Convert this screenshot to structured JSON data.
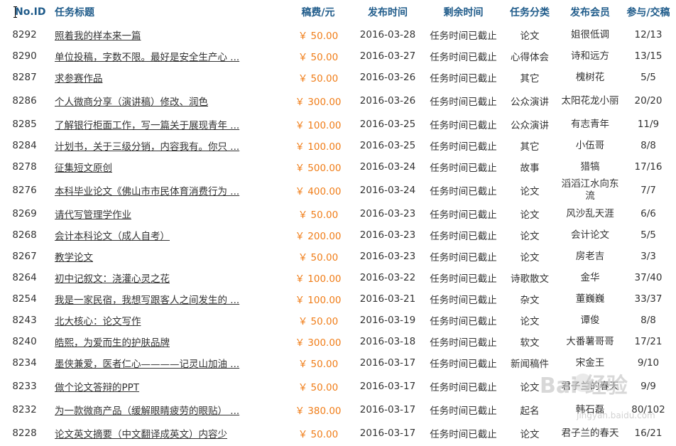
{
  "headers": {
    "id": "No.ID",
    "title": "任务标题",
    "fee": "稿费/元",
    "publish_time": "发布时间",
    "remaining": "剩余时间",
    "category": "任务分类",
    "member": "发布会员",
    "participation": "参与/交稿"
  },
  "rows": [
    {
      "id": "8292",
      "title": "照着我的样本来一篇",
      "fee": "￥ 50.00",
      "date": "2016-03-28",
      "remaining": "任务时间已截止",
      "category": "论文",
      "member": "姐很低调",
      "part": "12/13"
    },
    {
      "id": "8290",
      "title": "单位投稿，字数不限。最好是安全生产心 ...",
      "fee": "￥ 50.00",
      "date": "2016-03-27",
      "remaining": "任务时间已截止",
      "category": "心得体会",
      "member": "诗和远方",
      "part": "13/15"
    },
    {
      "id": "8287",
      "title": "求参赛作品",
      "fee": "￥ 50.00",
      "date": "2016-03-26",
      "remaining": "任务时间已截止",
      "category": "其它",
      "member": "槐树花",
      "part": "5/5"
    },
    {
      "id": "8286",
      "title": "个人微商分享（演讲稿）修改、润色",
      "fee": "￥ 300.00",
      "date": "2016-03-26",
      "remaining": "任务时间已截止",
      "category": "公众演讲",
      "member": "太阳花龙小丽",
      "part": "20/20",
      "tall": true
    },
    {
      "id": "8285",
      "title": "了解银行柜面工作，写一篇关于展现青年 ...",
      "fee": "￥ 100.00",
      "date": "2016-03-25",
      "remaining": "任务时间已截止",
      "category": "公众演讲",
      "member": "有志青年",
      "part": "11/9"
    },
    {
      "id": "8284",
      "title": "计划书，关于三级分销，内容我有。你只 ...",
      "fee": "￥ 100.00",
      "date": "2016-03-25",
      "remaining": "任务时间已截止",
      "category": "其它",
      "member": "小伍哥",
      "part": "8/8"
    },
    {
      "id": "8278",
      "title": "征集短文原创",
      "fee": "￥ 500.00",
      "date": "2016-03-24",
      "remaining": "任务时间已截止",
      "category": "故事",
      "member": "猎犒",
      "part": "17/16"
    },
    {
      "id": "8276",
      "title": "本科毕业论文《佛山市市民体育消费行为 ...",
      "fee": "￥ 400.00",
      "date": "2016-03-24",
      "remaining": "任务时间已截止",
      "category": "论文",
      "member": "滔滔江水向东流",
      "part": "7/7",
      "tall": true
    },
    {
      "id": "8269",
      "title": "请代写管理学作业",
      "fee": "￥ 50.00",
      "date": "2016-03-23",
      "remaining": "任务时间已截止",
      "category": "论文",
      "member": "风沙乱天涯",
      "part": "6/6"
    },
    {
      "id": "8268",
      "title": "会计本科论文（成人自考）",
      "fee": "￥ 200.00",
      "date": "2016-03-23",
      "remaining": "任务时间已截止",
      "category": "论文",
      "member": "会计论文",
      "part": "5/5"
    },
    {
      "id": "8267",
      "title": "教学论文",
      "fee": "￥ 50.00",
      "date": "2016-03-23",
      "remaining": "任务时间已截止",
      "category": "论文",
      "member": "房老吉",
      "part": "3/3"
    },
    {
      "id": "8264",
      "title": "初中记叙文：浇灌心灵之花",
      "fee": "￥ 100.00",
      "date": "2016-03-22",
      "remaining": "任务时间已截止",
      "category": "诗歌散文",
      "member": "金华",
      "part": "37/40"
    },
    {
      "id": "8254",
      "title": "我是一家民宿，我想写跟客人之间发生的 ...",
      "fee": "￥ 100.00",
      "date": "2016-03-21",
      "remaining": "任务时间已截止",
      "category": "杂文",
      "member": "董巍巍",
      "part": "33/37"
    },
    {
      "id": "8243",
      "title": "北大核心：论文写作",
      "fee": "￥ 50.00",
      "date": "2016-03-19",
      "remaining": "任务时间已截止",
      "category": "论文",
      "member": "谭俊",
      "part": "8/8"
    },
    {
      "id": "8240",
      "title": "皓熙，为爱而生的护肤品牌",
      "fee": "￥ 300.00",
      "date": "2016-03-18",
      "remaining": "任务时间已截止",
      "category": "软文",
      "member": "大番薯哥哥",
      "part": "17/21"
    },
    {
      "id": "8234",
      "title": "墨侠兼爱，医者仁心————记灵山加油 ...",
      "fee": "￥ 50.00",
      "date": "2016-03-17",
      "remaining": "任务时间已截止",
      "category": "新闻稿件",
      "member": "宋金王",
      "part": "9/10"
    },
    {
      "id": "8233",
      "title": "做个论文答辩的PPT",
      "fee": "￥ 50.00",
      "date": "2016-03-17",
      "remaining": "任务时间已截止",
      "category": "论文",
      "member": "君子兰的春天",
      "part": "9/9",
      "tall": true
    },
    {
      "id": "8232",
      "title": "为一款微商产品（缓解眼睛疲劳的眼贴） ...",
      "fee": "￥ 380.00",
      "date": "2016-03-17",
      "remaining": "任务时间已截止",
      "category": "起名",
      "member": "韩石磊",
      "part": "80/102"
    },
    {
      "id": "8228",
      "title": "论文英文摘要（中文翻译成英文）内容少",
      "fee": "￥ 50.00",
      "date": "2016-03-17",
      "remaining": "任务时间已截止",
      "category": "论文",
      "member": "君子兰的春天",
      "part": "16/21",
      "tall": true
    }
  ],
  "watermark": {
    "logo": "Bai 经验",
    "sub": "jingyan.baidu.com"
  }
}
